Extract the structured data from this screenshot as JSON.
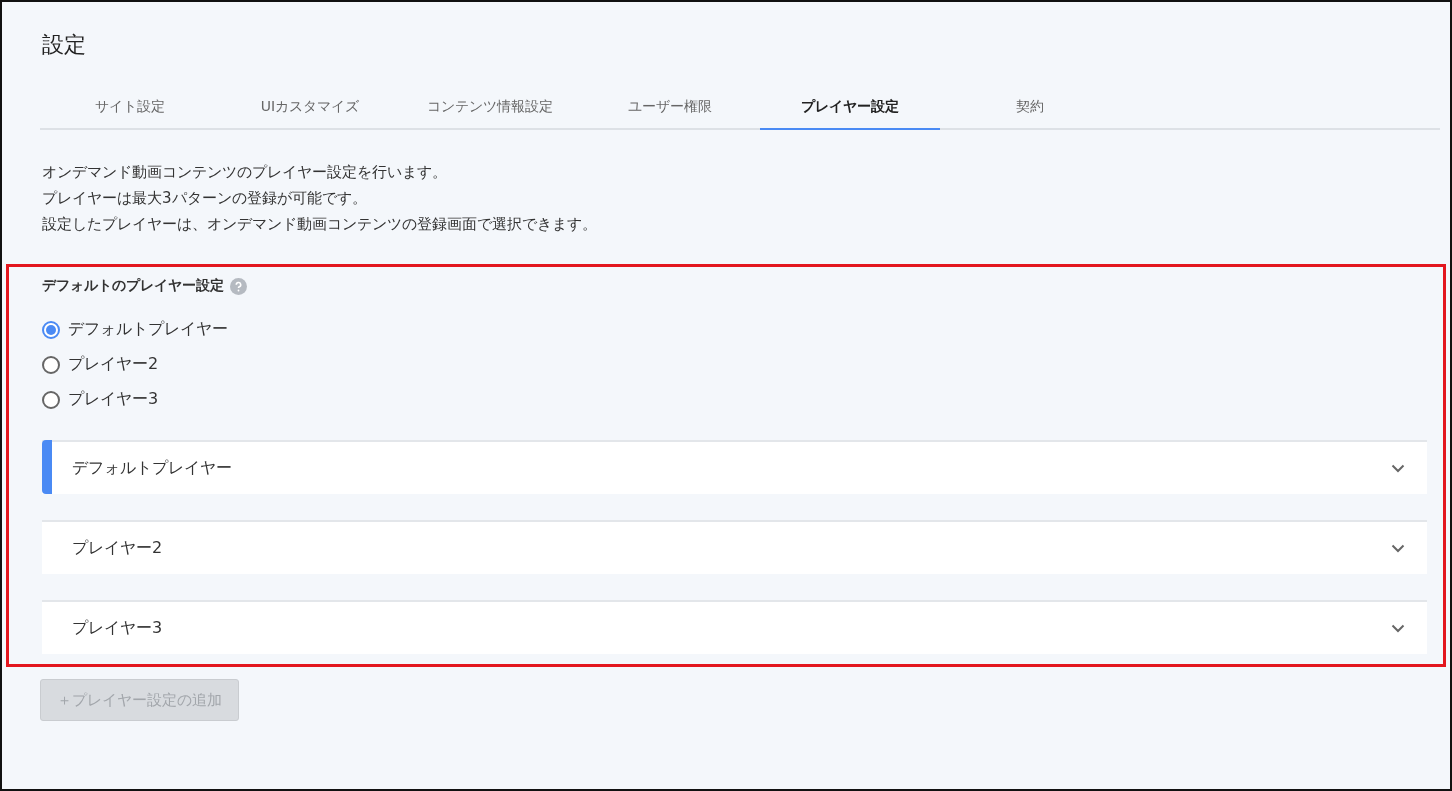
{
  "page": {
    "title": "設定"
  },
  "tabs": [
    {
      "label": "サイト設定",
      "selected": false
    },
    {
      "label": "UIカスタマイズ",
      "selected": false
    },
    {
      "label": "コンテンツ情報設定",
      "selected": false
    },
    {
      "label": "ユーザー権限",
      "selected": false
    },
    {
      "label": "プレイヤー設定",
      "selected": true
    },
    {
      "label": "契約",
      "selected": false
    }
  ],
  "description": [
    "オンデマンド動画コンテンツのプレイヤー設定を行います。",
    "プレイヤーは最大3パターンの登録が可能です。",
    "設定したプレイヤーは、オンデマンド動画コンテンツの登録画面で選択できます。"
  ],
  "default_player": {
    "label": "デフォルトのプレイヤー設定",
    "options": [
      {
        "label": "デフォルトプレイヤー",
        "selected": true
      },
      {
        "label": "プレイヤー2",
        "selected": false
      },
      {
        "label": "プレイヤー3",
        "selected": false
      }
    ]
  },
  "players": [
    {
      "title": "デフォルトプレイヤー",
      "highlighted": true,
      "expanded": false
    },
    {
      "title": "プレイヤー2",
      "highlighted": false,
      "expanded": false
    },
    {
      "title": "プレイヤー3",
      "highlighted": false,
      "expanded": false
    }
  ],
  "add_button": {
    "label": "＋プレイヤー設定の追加",
    "disabled": true
  }
}
